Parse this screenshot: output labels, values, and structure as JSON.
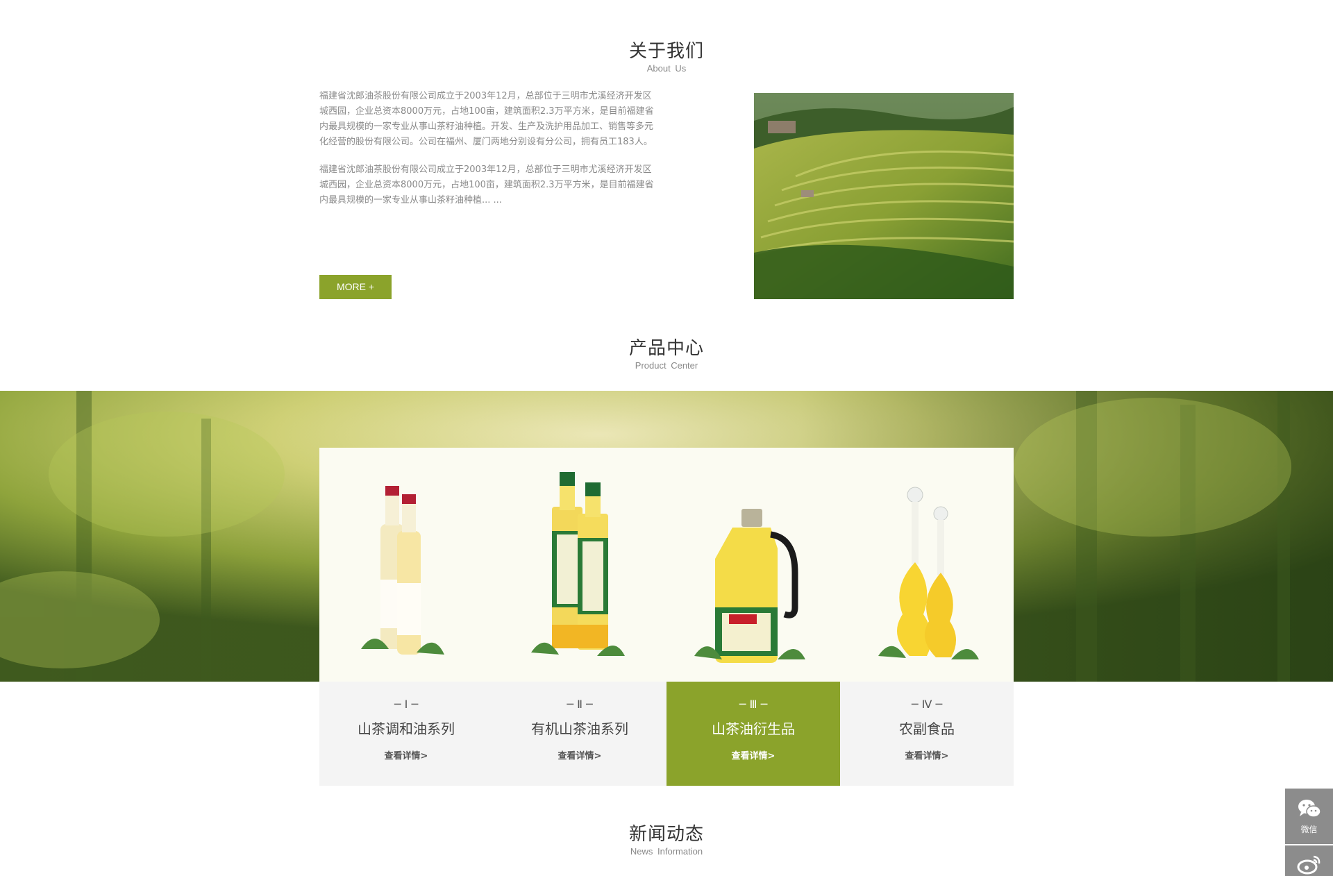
{
  "about": {
    "title_cn": "关于我们",
    "title_en": "About  Us",
    "paragraph1": "福建省沈郎油茶股份有限公司成立于2003年12月，总部位于三明市尤溪经济开发区城西园，企业总资本8000万元，占地100亩，建筑面积2.3万平方米，是目前福建省内最具规模的一家专业从事山茶籽油种植。开发、生产及洗护用品加工、销售等多元化经营的股份有限公司。公司在福州、厦门两地分别设有分公司，拥有员工183人。",
    "paragraph2": "福建省沈郎油茶股份有限公司成立于2003年12月，总部位于三明市尤溪经济开发区城西园，企业总资本8000万元，占地100亩，建筑面积2.3万平方米，是目前福建省内最具规模的一家专业从事山茶籽油种植... ...",
    "more_label": "MORE +"
  },
  "products": {
    "title_cn": "产品中心",
    "title_en": "Product  Center",
    "items": [
      {
        "num": "─ Ⅰ ─",
        "name": "山茶调和油系列",
        "link": "查看详情>"
      },
      {
        "num": "─ Ⅱ ─",
        "name": "有机山茶油系列",
        "link": "查看详情>"
      },
      {
        "num": "─ Ⅲ ─",
        "name": "山茶油衍生品",
        "link": "查看详情>"
      },
      {
        "num": "─ Ⅳ ─",
        "name": "农副食品",
        "link": "查看详情>"
      }
    ],
    "active_index": 2
  },
  "news": {
    "title_cn": "新闻动态",
    "title_en": "News  Information"
  },
  "side": {
    "wechat_label": "微信"
  },
  "colors": {
    "accent": "#8ba32b",
    "card_bg": "#f4f4f4",
    "side_bg": "#8c8c8c"
  }
}
